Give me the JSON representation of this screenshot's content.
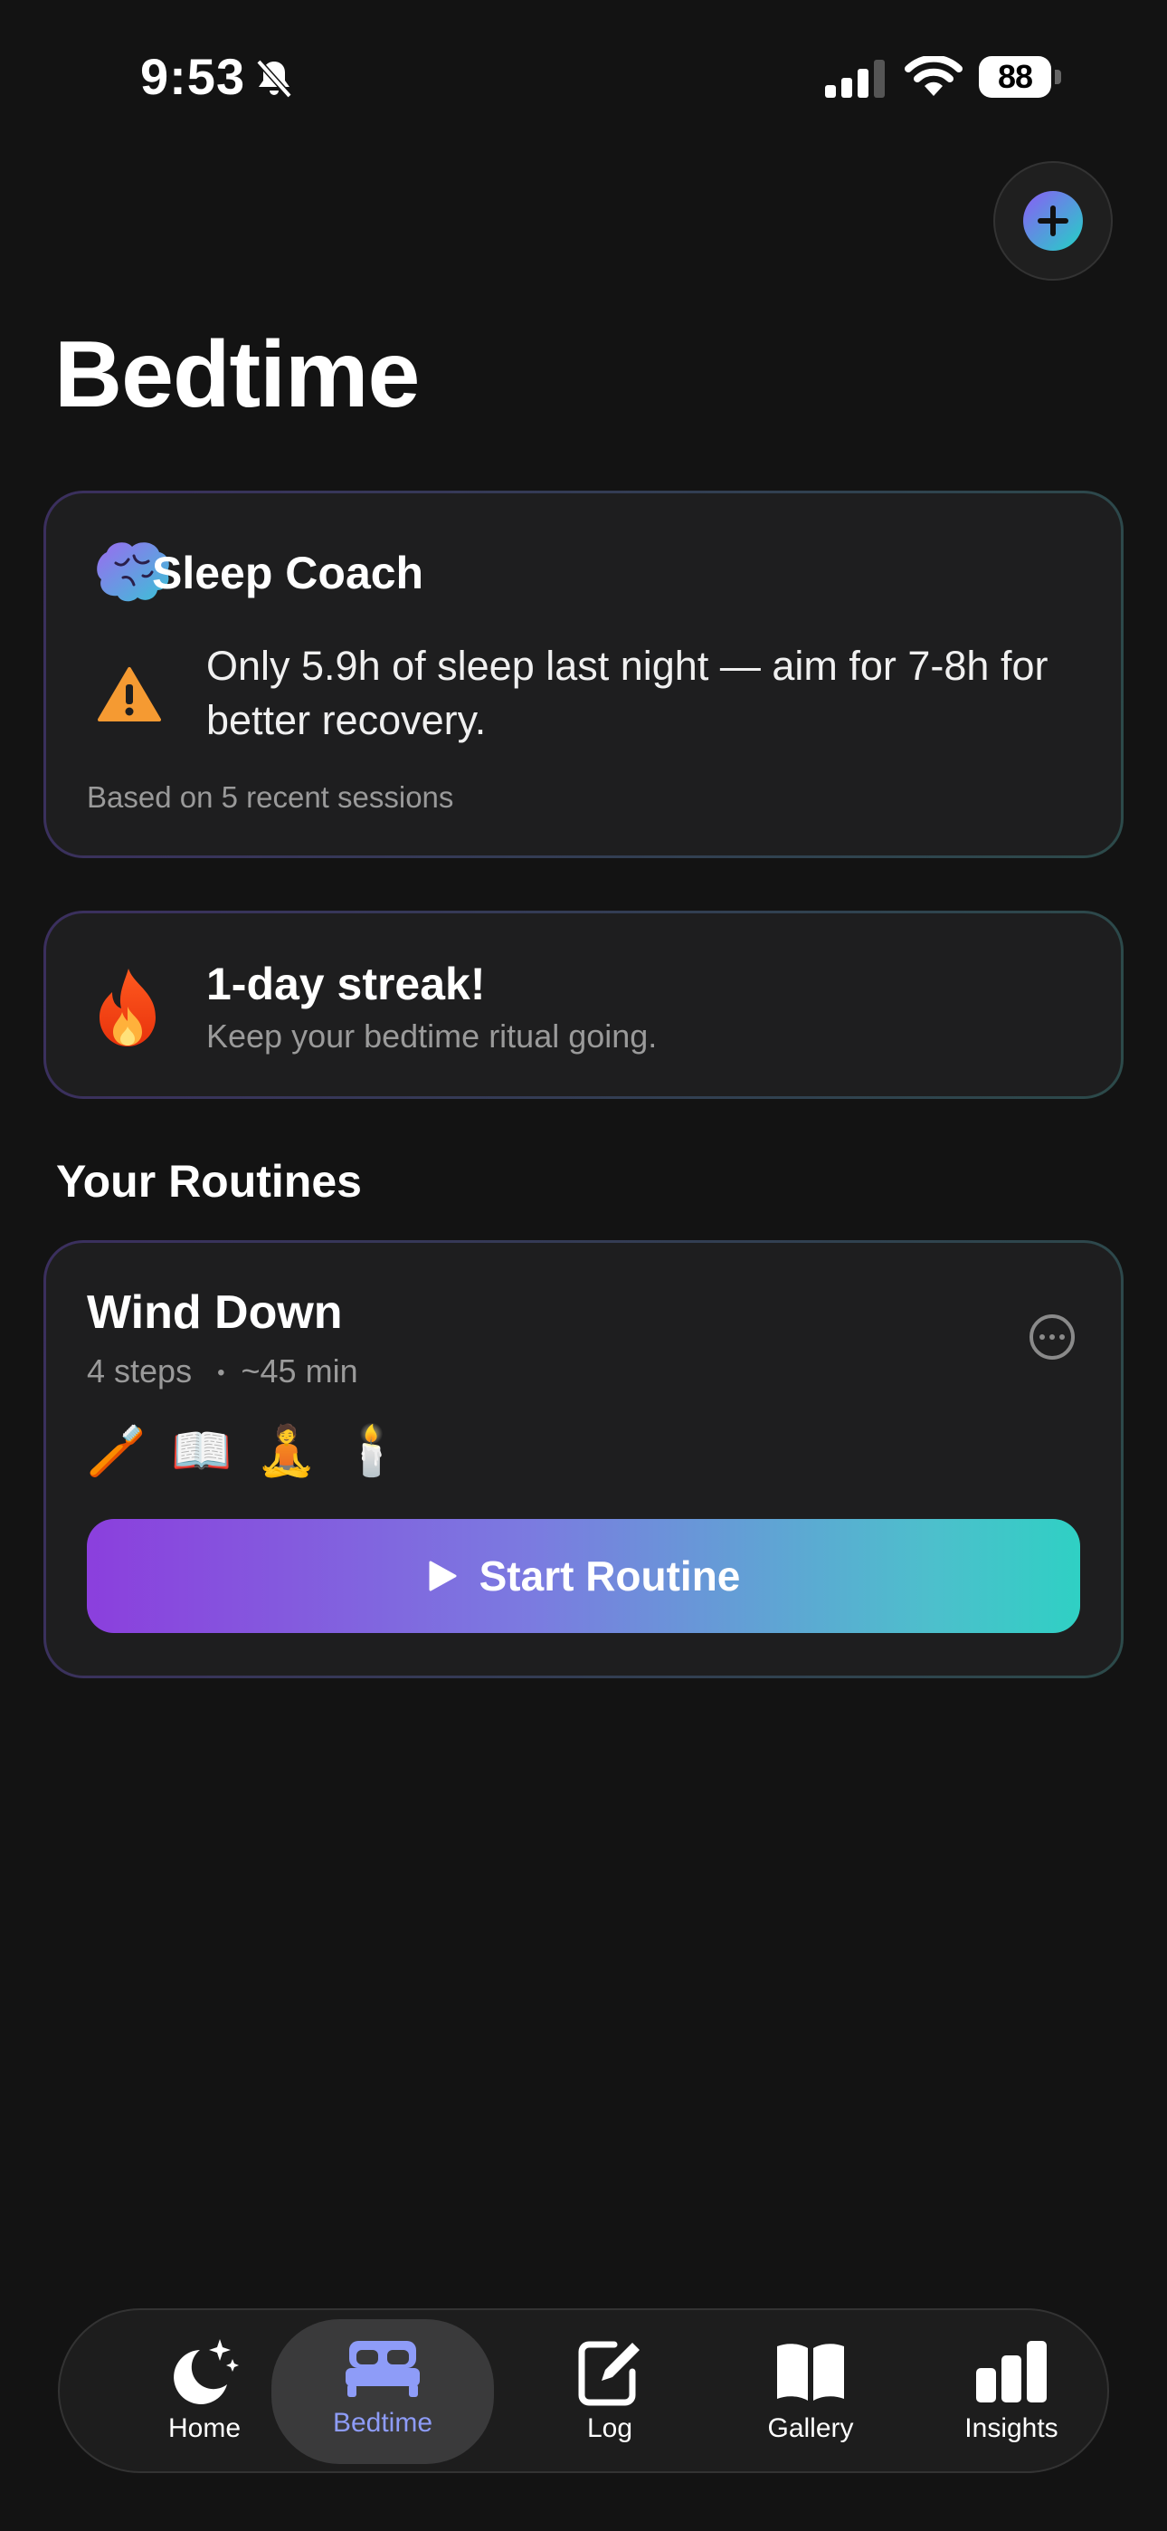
{
  "status_bar": {
    "time": "9:53",
    "battery": "88"
  },
  "page": {
    "title": "Bedtime"
  },
  "sleep_coach": {
    "title": "Sleep Coach",
    "message": "Only 5.9h of sleep last night — aim for 7-8h for better recovery.",
    "note": "Based on 5 recent sessions"
  },
  "streak": {
    "title": "1-day streak!",
    "subtitle": "Keep your bedtime ritual going."
  },
  "routines": {
    "section_title": "Your Routines",
    "items": [
      {
        "title": "Wind Down",
        "steps": "4 steps",
        "separator": "•",
        "duration": "~45 min",
        "step_icons": [
          "🪥",
          "📖",
          "🧘",
          "🕯️"
        ],
        "start_label": "Start Routine"
      }
    ]
  },
  "tab_bar": {
    "tabs": [
      {
        "label": "Home",
        "icon": "moon-stars-icon"
      },
      {
        "label": "Bedtime",
        "icon": "bed-icon",
        "active": true
      },
      {
        "label": "Log",
        "icon": "edit-icon"
      },
      {
        "label": "Gallery",
        "icon": "book-open-icon"
      },
      {
        "label": "Insights",
        "icon": "bar-chart-icon"
      }
    ]
  },
  "colors": {
    "background": "#131313",
    "card": "#1e1e1f",
    "accent_purple": "#8b3fdd",
    "accent_teal": "#2fd0c4",
    "active_tab": "#8e9cf8",
    "warning": "#f59a32"
  }
}
